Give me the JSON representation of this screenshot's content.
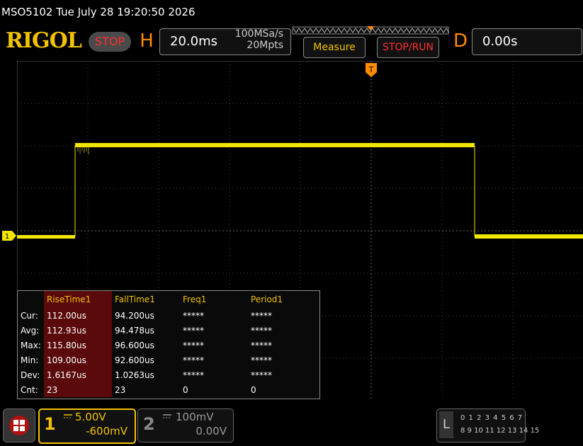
{
  "titlebar": {
    "text": "MSO5102  Tue July 28 19:20:50 2026"
  },
  "header": {
    "logo": "RIGOL",
    "status": "STOP",
    "horizontal_letter": "H",
    "timebase": "20.0ms",
    "sample_rate": "100MSa/s",
    "memory_depth": "20Mpts",
    "measure_label": "Measure",
    "stoprun_label": "STOP/RUN",
    "delay_letter": "D",
    "delay": "0.00s"
  },
  "screen": {
    "trigger_marker": "T",
    "channel_marker": "1",
    "colors": {
      "trace": "#f2e600",
      "grid": "#4a4a4a",
      "accent": "#f2c200",
      "stop": "#ff3030",
      "orange": "#ff8c00"
    }
  },
  "measurements": {
    "headers": [
      "RiseTime1",
      "FallTime1",
      "Freq1",
      "Period1"
    ],
    "rows": [
      {
        "label": "Cur:",
        "values": [
          "112.00us",
          "94.200us",
          "*****",
          "*****"
        ]
      },
      {
        "label": "Avg:",
        "values": [
          "112.93us",
          "94.478us",
          "*****",
          "*****"
        ]
      },
      {
        "label": "Max:",
        "values": [
          "115.80us",
          "96.600us",
          "*****",
          "*****"
        ]
      },
      {
        "label": "Min:",
        "values": [
          "109.00us",
          "92.600us",
          "*****",
          "*****"
        ]
      },
      {
        "label": "Dev:",
        "values": [
          "1.6167us",
          "1.0263us",
          "*****",
          "*****"
        ]
      },
      {
        "label": "Cnt:",
        "values": [
          "23",
          "23",
          "0",
          "0"
        ]
      }
    ]
  },
  "footer": {
    "ch1": {
      "number": "1",
      "scale": "5.00V",
      "offset": "-600mV"
    },
    "ch2": {
      "number": "2",
      "scale": "100mV",
      "offset": "0.00V"
    },
    "la": {
      "letter": "L",
      "row1": "0 1 2 3  4 5 6 7",
      "row2": "8 9 10 11 12 13 14 15"
    }
  }
}
